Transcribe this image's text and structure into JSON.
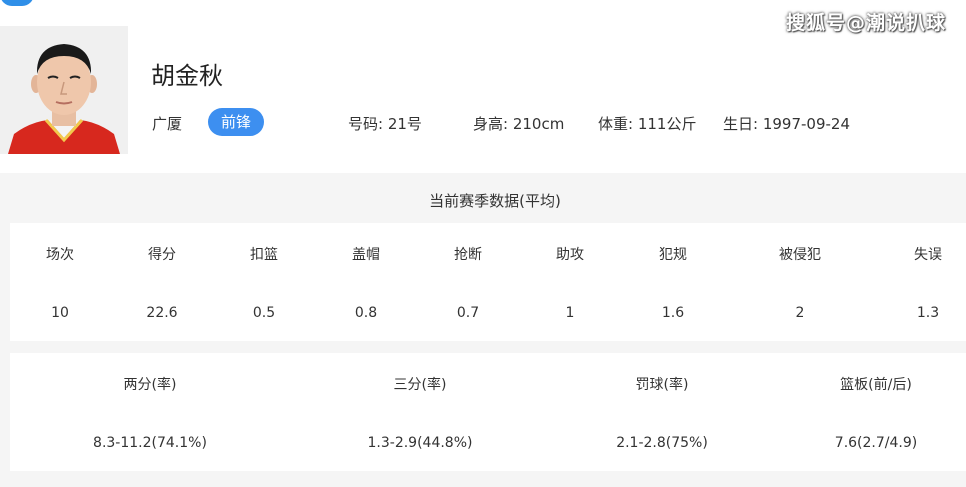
{
  "watermark": "搜狐号@潮说扒球",
  "player": {
    "name": "胡金秋",
    "team": "广厦",
    "position": "前锋",
    "number": "号码: 21号",
    "height": "身高: 210cm",
    "weight": "体重: 111公斤",
    "birthday": "生日: 1997-09-24"
  },
  "season": {
    "title": "当前赛季数据(平均)",
    "basic": [
      {
        "label": "场次",
        "value": "10"
      },
      {
        "label": "得分",
        "value": "22.6"
      },
      {
        "label": "扣篮",
        "value": "0.5"
      },
      {
        "label": "盖帽",
        "value": "0.8"
      },
      {
        "label": "抢断",
        "value": "0.7"
      },
      {
        "label": "助攻",
        "value": "1"
      },
      {
        "label": "犯规",
        "value": "1.6"
      },
      {
        "label": "被侵犯",
        "value": "2"
      },
      {
        "label": "失误",
        "value": "1.3"
      }
    ],
    "shooting": [
      {
        "label": "两分(率)",
        "value": "8.3-11.2(74.1%)"
      },
      {
        "label": "三分(率)",
        "value": "1.3-2.9(44.8%)"
      },
      {
        "label": "罚球(率)",
        "value": "2.1-2.8(75%)"
      },
      {
        "label": "篮板(前/后)",
        "value": "7.6(2.7/4.9)"
      }
    ]
  },
  "colors": {
    "accent": "#3d8ff0",
    "jersey": "#d7281e",
    "panel_bg": "#f5f5f5"
  }
}
